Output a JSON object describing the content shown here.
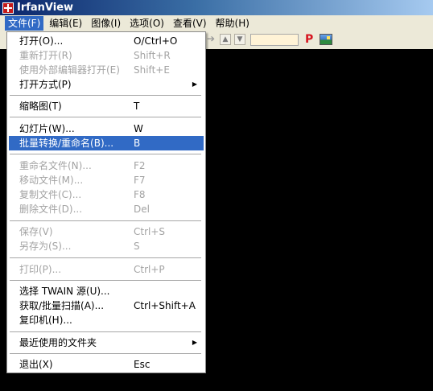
{
  "window": {
    "title": "IrfanView",
    "icon": "irfanview-app-icon"
  },
  "menubar": {
    "items": [
      {
        "label": "文件(F)",
        "active": true
      },
      {
        "label": "编辑(E)"
      },
      {
        "label": "图像(I)"
      },
      {
        "label": "选项(O)"
      },
      {
        "label": "查看(V)"
      },
      {
        "label": "帮助(H)"
      }
    ]
  },
  "toolbar": {
    "icons": [
      "arrow-right-icon",
      "move-up-icon",
      "move-down-icon",
      "zoom-field",
      "paint-icon",
      "image-icon"
    ],
    "paint_label": "P"
  },
  "file_menu": {
    "items": [
      {
        "label": "打开(O)...",
        "shortcut": "O/Ctrl+O",
        "enabled": true
      },
      {
        "label": "重新打开(R)",
        "shortcut": "Shift+R",
        "enabled": false
      },
      {
        "label": "使用外部编辑器打开(E)",
        "shortcut": "Shift+E",
        "enabled": false
      },
      {
        "label": "打开方式(P)",
        "submenu": true,
        "enabled": true
      },
      {
        "label": "缩略图(T)",
        "shortcut": "T",
        "enabled": true
      },
      {
        "label": "幻灯片(W)...",
        "shortcut": "W",
        "enabled": true
      },
      {
        "label": "批量转换/重命名(B)...",
        "shortcut": "B",
        "enabled": true,
        "highlighted": true
      },
      {
        "label": "重命名文件(N)...",
        "shortcut": "F2",
        "enabled": false
      },
      {
        "label": "移动文件(M)...",
        "shortcut": "F7",
        "enabled": false
      },
      {
        "label": "复制文件(C)...",
        "shortcut": "F8",
        "enabled": false
      },
      {
        "label": "删除文件(D)...",
        "shortcut": "Del",
        "enabled": false
      },
      {
        "label": "保存(V)",
        "shortcut": "Ctrl+S",
        "enabled": false
      },
      {
        "label": "另存为(S)...",
        "shortcut": "S",
        "enabled": false
      },
      {
        "label": "打印(P)...",
        "shortcut": "Ctrl+P",
        "enabled": false
      },
      {
        "label": "选择 TWAIN 源(U)...",
        "enabled": true
      },
      {
        "label": "获取/批量扫描(A)...",
        "shortcut": "Ctrl+Shift+A",
        "enabled": true
      },
      {
        "label": "复印机(H)...",
        "enabled": true
      },
      {
        "label": "最近使用的文件夹",
        "submenu": true,
        "enabled": true
      },
      {
        "label": "退出(X)",
        "shortcut": "Esc",
        "enabled": true
      }
    ]
  },
  "colors": {
    "highlight": "#316ac5",
    "menubar": "#ece9d8",
    "disabled_text": "#a3a3a3",
    "workspace": "#000000"
  }
}
